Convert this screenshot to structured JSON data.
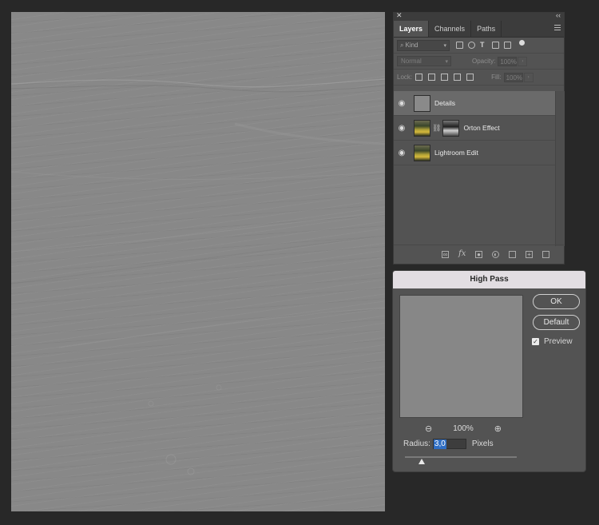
{
  "layers_panel": {
    "tabs": [
      "Layers",
      "Channels",
      "Paths"
    ],
    "filter": {
      "placeholder": "Kind"
    },
    "blend_mode": "Normal",
    "opacity_label": "Opacity:",
    "opacity_value": "100%",
    "lock_label": "Lock:",
    "fill_label": "Fill:",
    "fill_value": "100%",
    "layers": [
      {
        "name": "Details",
        "visible": true,
        "selected": true,
        "thumb": "gray"
      },
      {
        "name": "Orton Effect",
        "visible": true,
        "selected": false,
        "thumb": "photo",
        "mask": true
      },
      {
        "name": "Lightroom Edit",
        "visible": true,
        "selected": false,
        "thumb": "photo"
      }
    ],
    "footer_icons": [
      "link-icon",
      "fx-icon",
      "mask-icon",
      "adjustment-icon",
      "folder-icon",
      "new-layer-icon",
      "trash-icon"
    ],
    "footer_fx": "fx"
  },
  "high_pass": {
    "title": "High Pass",
    "ok_label": "OK",
    "default_label": "Default",
    "preview_label": "Preview",
    "preview_checked": true,
    "zoom_level": "100%",
    "radius_label": "Radius:",
    "radius_value": "3,0",
    "radius_units": "Pixels"
  },
  "colors": {
    "canvas": "#888888",
    "background": "#282828",
    "panel": "#535353",
    "selection": "#2f6ec4"
  }
}
